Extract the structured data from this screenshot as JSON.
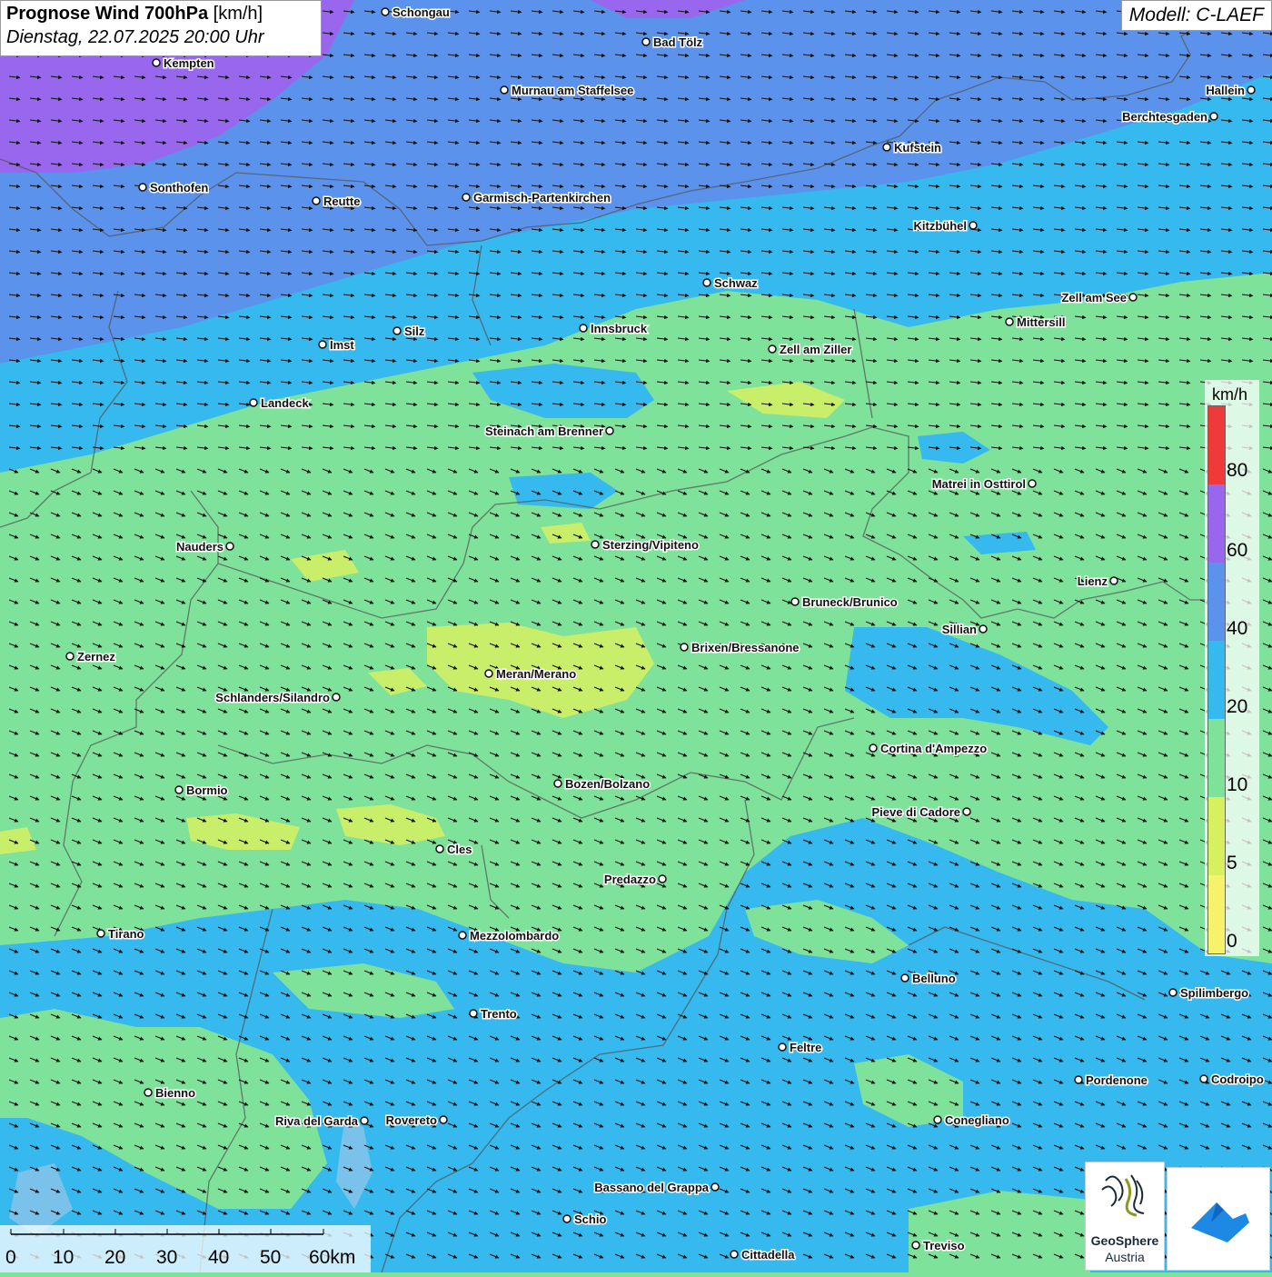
{
  "header": {
    "title_bold": "Prognose Wind 700hPa",
    "title_unit": "[km/h]",
    "datetime": "Dienstag, 22.07.2025 20:00 Uhr",
    "model": "Modell: C-LAEF"
  },
  "legend": {
    "unit": "km/h",
    "ticks": [
      "80",
      "60",
      "40",
      "20",
      "10",
      "5",
      "0"
    ],
    "colors": {
      "c80": "#f03a3a",
      "c60": "#9966ee",
      "c40": "#5b93ec",
      "c20": "#35b9ee",
      "c10": "#7ee29a",
      "c5": "#d6f060",
      "c0": "#f6f36a"
    }
  },
  "scalebar": {
    "labels": [
      "0",
      "10",
      "20",
      "30",
      "40",
      "50",
      "60km"
    ]
  },
  "cities": [
    {
      "name": "Schongau"
    },
    {
      "name": "Bad Tölz"
    },
    {
      "name": "Kempten"
    },
    {
      "name": "Murnau am Staffelsee"
    },
    {
      "name": "Hallein"
    },
    {
      "name": "Berchtesgaden"
    },
    {
      "name": "Kufstein"
    },
    {
      "name": "Sonthofen"
    },
    {
      "name": "Reutte"
    },
    {
      "name": "Garmisch-Partenkirchen"
    },
    {
      "name": "Kitzbühel"
    },
    {
      "name": "Schwaz"
    },
    {
      "name": "Zell am See"
    },
    {
      "name": "Mittersill"
    },
    {
      "name": "Innsbruck"
    },
    {
      "name": "Silz"
    },
    {
      "name": "Imst"
    },
    {
      "name": "Zell am Ziller"
    },
    {
      "name": "Landeck"
    },
    {
      "name": "Steinach am Brenner"
    },
    {
      "name": "Matrei in Osttirol"
    },
    {
      "name": "Nauders"
    },
    {
      "name": "Sterzing/Vipiteno"
    },
    {
      "name": "Lienz"
    },
    {
      "name": "Bruneck/Brunico"
    },
    {
      "name": "Sillian"
    },
    {
      "name": "Zernez"
    },
    {
      "name": "Brixen/Bressanone"
    },
    {
      "name": "Meran/Merano"
    },
    {
      "name": "Schlanders/Silandro"
    },
    {
      "name": "Cortina d'Ampezzo"
    },
    {
      "name": "Bozen/Bolzano"
    },
    {
      "name": "Bormio"
    },
    {
      "name": "Pieve di Cadore"
    },
    {
      "name": "Cles"
    },
    {
      "name": "Predazzo"
    },
    {
      "name": "Tirano"
    },
    {
      "name": "Mezzolombardo"
    },
    {
      "name": "Belluno"
    },
    {
      "name": "Spilimbergo"
    },
    {
      "name": "Trento"
    },
    {
      "name": "Feltre"
    },
    {
      "name": "Pordenone"
    },
    {
      "name": "Codroipo"
    },
    {
      "name": "Bienno"
    },
    {
      "name": "Riva del Garda"
    },
    {
      "name": "Rovereto"
    },
    {
      "name": "Conegliano"
    },
    {
      "name": "Bassano del Grappa"
    },
    {
      "name": "Schio"
    },
    {
      "name": "Treviso"
    },
    {
      "name": "Cittadella"
    }
  ],
  "logos": {
    "geosphere_name": "GeoSphere",
    "geosphere_sub": "Austria"
  }
}
